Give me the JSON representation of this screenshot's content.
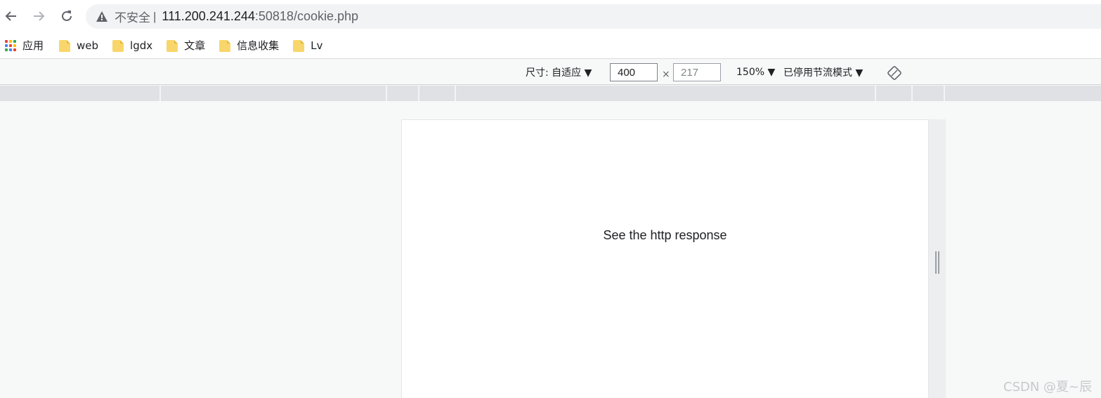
{
  "address_bar": {
    "security_label": "不安全",
    "separator": "|",
    "url_host": "111.200.241.244",
    "url_rest": ":50818/cookie.php"
  },
  "bookmarks": [
    {
      "label": "应用",
      "icon": "apps-grid-icon"
    },
    {
      "label": "web",
      "icon": "folder-icon"
    },
    {
      "label": "lgdx",
      "icon": "folder-icon"
    },
    {
      "label": "文章",
      "icon": "folder-icon"
    },
    {
      "label": "信息收集",
      "icon": "folder-icon"
    },
    {
      "label": "Lv",
      "icon": "folder-icon"
    }
  ],
  "device_toolbar": {
    "dimensions_label": "尺寸: 自适应 ▼",
    "width_value": "400",
    "times": "×",
    "height_placeholder": "217",
    "zoom_label": "150% ▼",
    "throttle_label": "已停用节流模式 ▼"
  },
  "page": {
    "text": "See the http response"
  },
  "watermark": "CSDN @夏~辰"
}
